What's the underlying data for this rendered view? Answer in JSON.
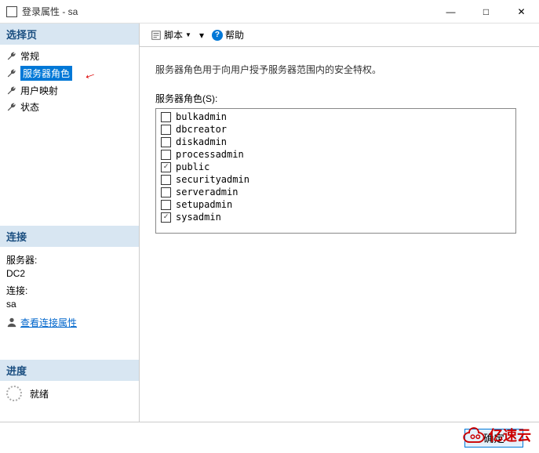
{
  "window": {
    "title": "登录属性 - sa",
    "minimize": "—",
    "maximize": "□",
    "close": "✕"
  },
  "sidebar": {
    "select_page": "选择页",
    "items": [
      {
        "label": "常规"
      },
      {
        "label": "服务器角色"
      },
      {
        "label": "用户映射"
      },
      {
        "label": "状态"
      }
    ],
    "connection_header": "连接",
    "server_label": "服务器:",
    "server_value": "DC2",
    "conn_label": "连接:",
    "conn_value": "sa",
    "view_props": "查看连接属性",
    "progress_header": "进度",
    "progress_status": "就绪"
  },
  "toolbar": {
    "script": "脚本",
    "help": "帮助"
  },
  "content": {
    "description": "服务器角色用于向用户授予服务器范围内的安全特权。",
    "roles_label": "服务器角色(S):",
    "roles": [
      {
        "name": "bulkadmin",
        "checked": false
      },
      {
        "name": "dbcreator",
        "checked": false
      },
      {
        "name": "diskadmin",
        "checked": false
      },
      {
        "name": "processadmin",
        "checked": false
      },
      {
        "name": "public",
        "checked": true
      },
      {
        "name": "securityadmin",
        "checked": false
      },
      {
        "name": "serveradmin",
        "checked": false
      },
      {
        "name": "setupadmin",
        "checked": false
      },
      {
        "name": "sysadmin",
        "checked": true
      }
    ]
  },
  "footer": {
    "ok": "确定"
  },
  "watermark": {
    "text": "亿速云"
  }
}
